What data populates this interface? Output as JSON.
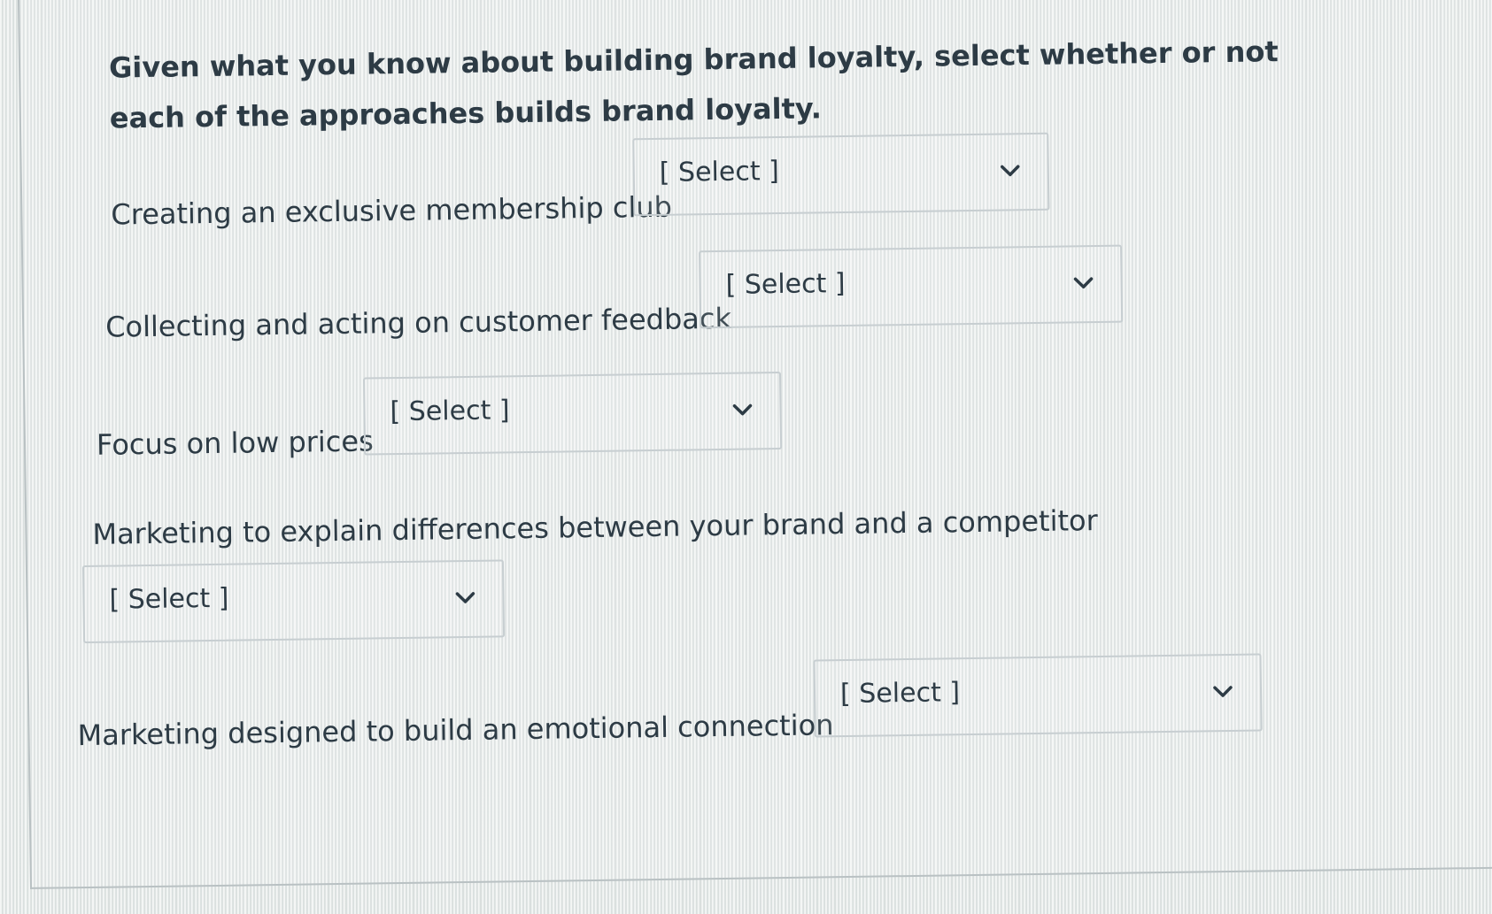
{
  "question": {
    "text": "Given what you know about building brand loyalty, select whether or not each of the approaches builds brand loyalty."
  },
  "items": [
    {
      "label": "Creating an exclusive membership club",
      "select_value": "[ Select ]"
    },
    {
      "label": "Collecting and acting on customer feedback",
      "select_value": "[ Select ]"
    },
    {
      "label": "Focus on low prices",
      "select_value": "[ Select ]"
    },
    {
      "label": "Marketing to explain differences between your brand and a competitor",
      "select_value": "[ Select ]"
    },
    {
      "label": "Marketing designed to build an emotional connection",
      "select_value": "[ Select ]"
    }
  ],
  "colors": {
    "text": "#2d3b45",
    "select_border": "#c7ced1",
    "background": "#e6ebe9"
  },
  "icons": {
    "dropdown": "chevron-down-icon"
  }
}
